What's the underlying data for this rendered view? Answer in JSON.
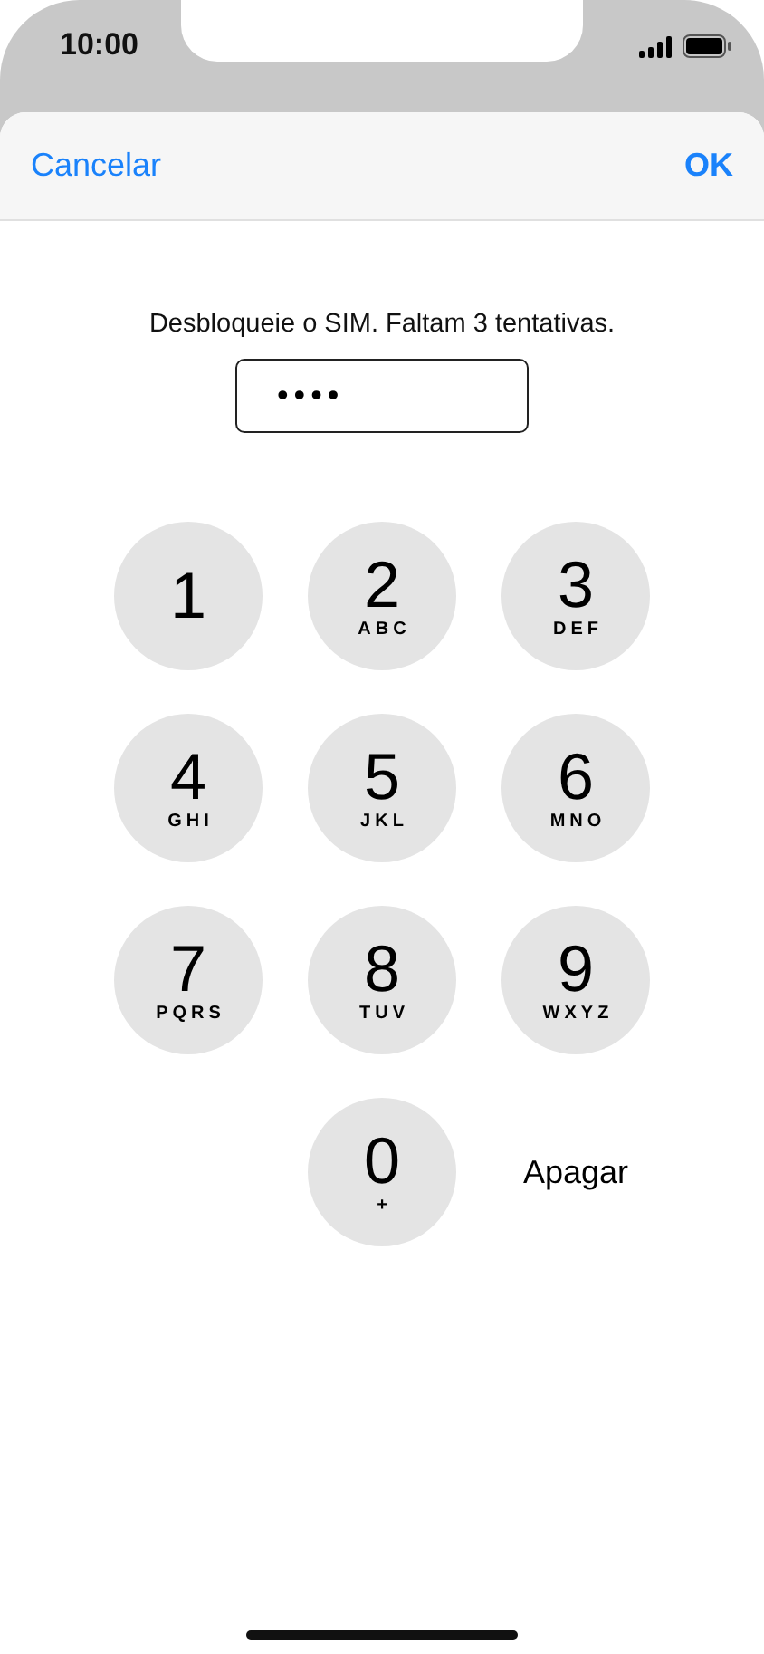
{
  "status_bar": {
    "time": "10:00"
  },
  "nav_bar": {
    "cancel": "Cancelar",
    "confirm": "OK"
  },
  "prompt": "Desbloqueie o SIM. Faltam 3 tentativas.",
  "pin_field": {
    "value": "••••"
  },
  "keypad": [
    {
      "kind": "digit",
      "digit": "1"
    },
    {
      "kind": "digit",
      "digit": "2",
      "letters": "ABC"
    },
    {
      "kind": "digit",
      "digit": "3",
      "letters": "DEF"
    },
    {
      "kind": "digit",
      "digit": "4",
      "letters": "GHI"
    },
    {
      "kind": "digit",
      "digit": "5",
      "letters": "JKL"
    },
    {
      "kind": "digit",
      "digit": "6",
      "letters": "MNO"
    },
    {
      "kind": "digit",
      "digit": "7",
      "letters": "PQRS"
    },
    {
      "kind": "digit",
      "digit": "8",
      "letters": "TUV"
    },
    {
      "kind": "digit",
      "digit": "9",
      "letters": "WXYZ"
    },
    {
      "kind": "digit",
      "digit": "0",
      "letters": "+"
    },
    {
      "kind": "action",
      "label": "Apagar"
    }
  ]
}
